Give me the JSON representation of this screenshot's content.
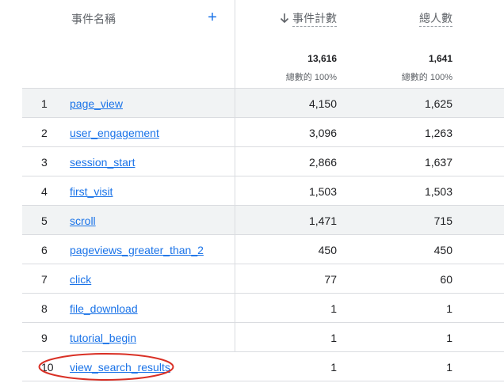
{
  "header": {
    "event_name_label": "事件名稱",
    "add_label": "+",
    "event_count_label": "事件計數",
    "total_users_label": "總人數"
  },
  "totals": {
    "event_count": "13,616",
    "event_count_pct": "總數的 100%",
    "total_users": "1,641",
    "total_users_pct": "總數的 100%"
  },
  "rows": [
    {
      "idx": "1",
      "name": "page_view",
      "events": "4,150",
      "users": "1,625"
    },
    {
      "idx": "2",
      "name": "user_engagement",
      "events": "3,096",
      "users": "1,263"
    },
    {
      "idx": "3",
      "name": "session_start",
      "events": "2,866",
      "users": "1,637"
    },
    {
      "idx": "4",
      "name": "first_visit",
      "events": "1,503",
      "users": "1,503"
    },
    {
      "idx": "5",
      "name": "scroll",
      "events": "1,471",
      "users": "715"
    },
    {
      "idx": "6",
      "name": "pageviews_greater_than_2",
      "events": "450",
      "users": "450"
    },
    {
      "idx": "7",
      "name": "click",
      "events": "77",
      "users": "60"
    },
    {
      "idx": "8",
      "name": "file_download",
      "events": "1",
      "users": "1"
    },
    {
      "idx": "9",
      "name": "tutorial_begin",
      "events": "1",
      "users": "1"
    },
    {
      "idx": "10",
      "name": "view_search_results",
      "events": "1",
      "users": "1"
    }
  ],
  "colors": {
    "link": "#1a73e8",
    "alt_row": "#f1f3f4",
    "annotation": "#d93025"
  },
  "icons": {
    "sort": "arrow-down-icon",
    "add": "plus-icon"
  }
}
